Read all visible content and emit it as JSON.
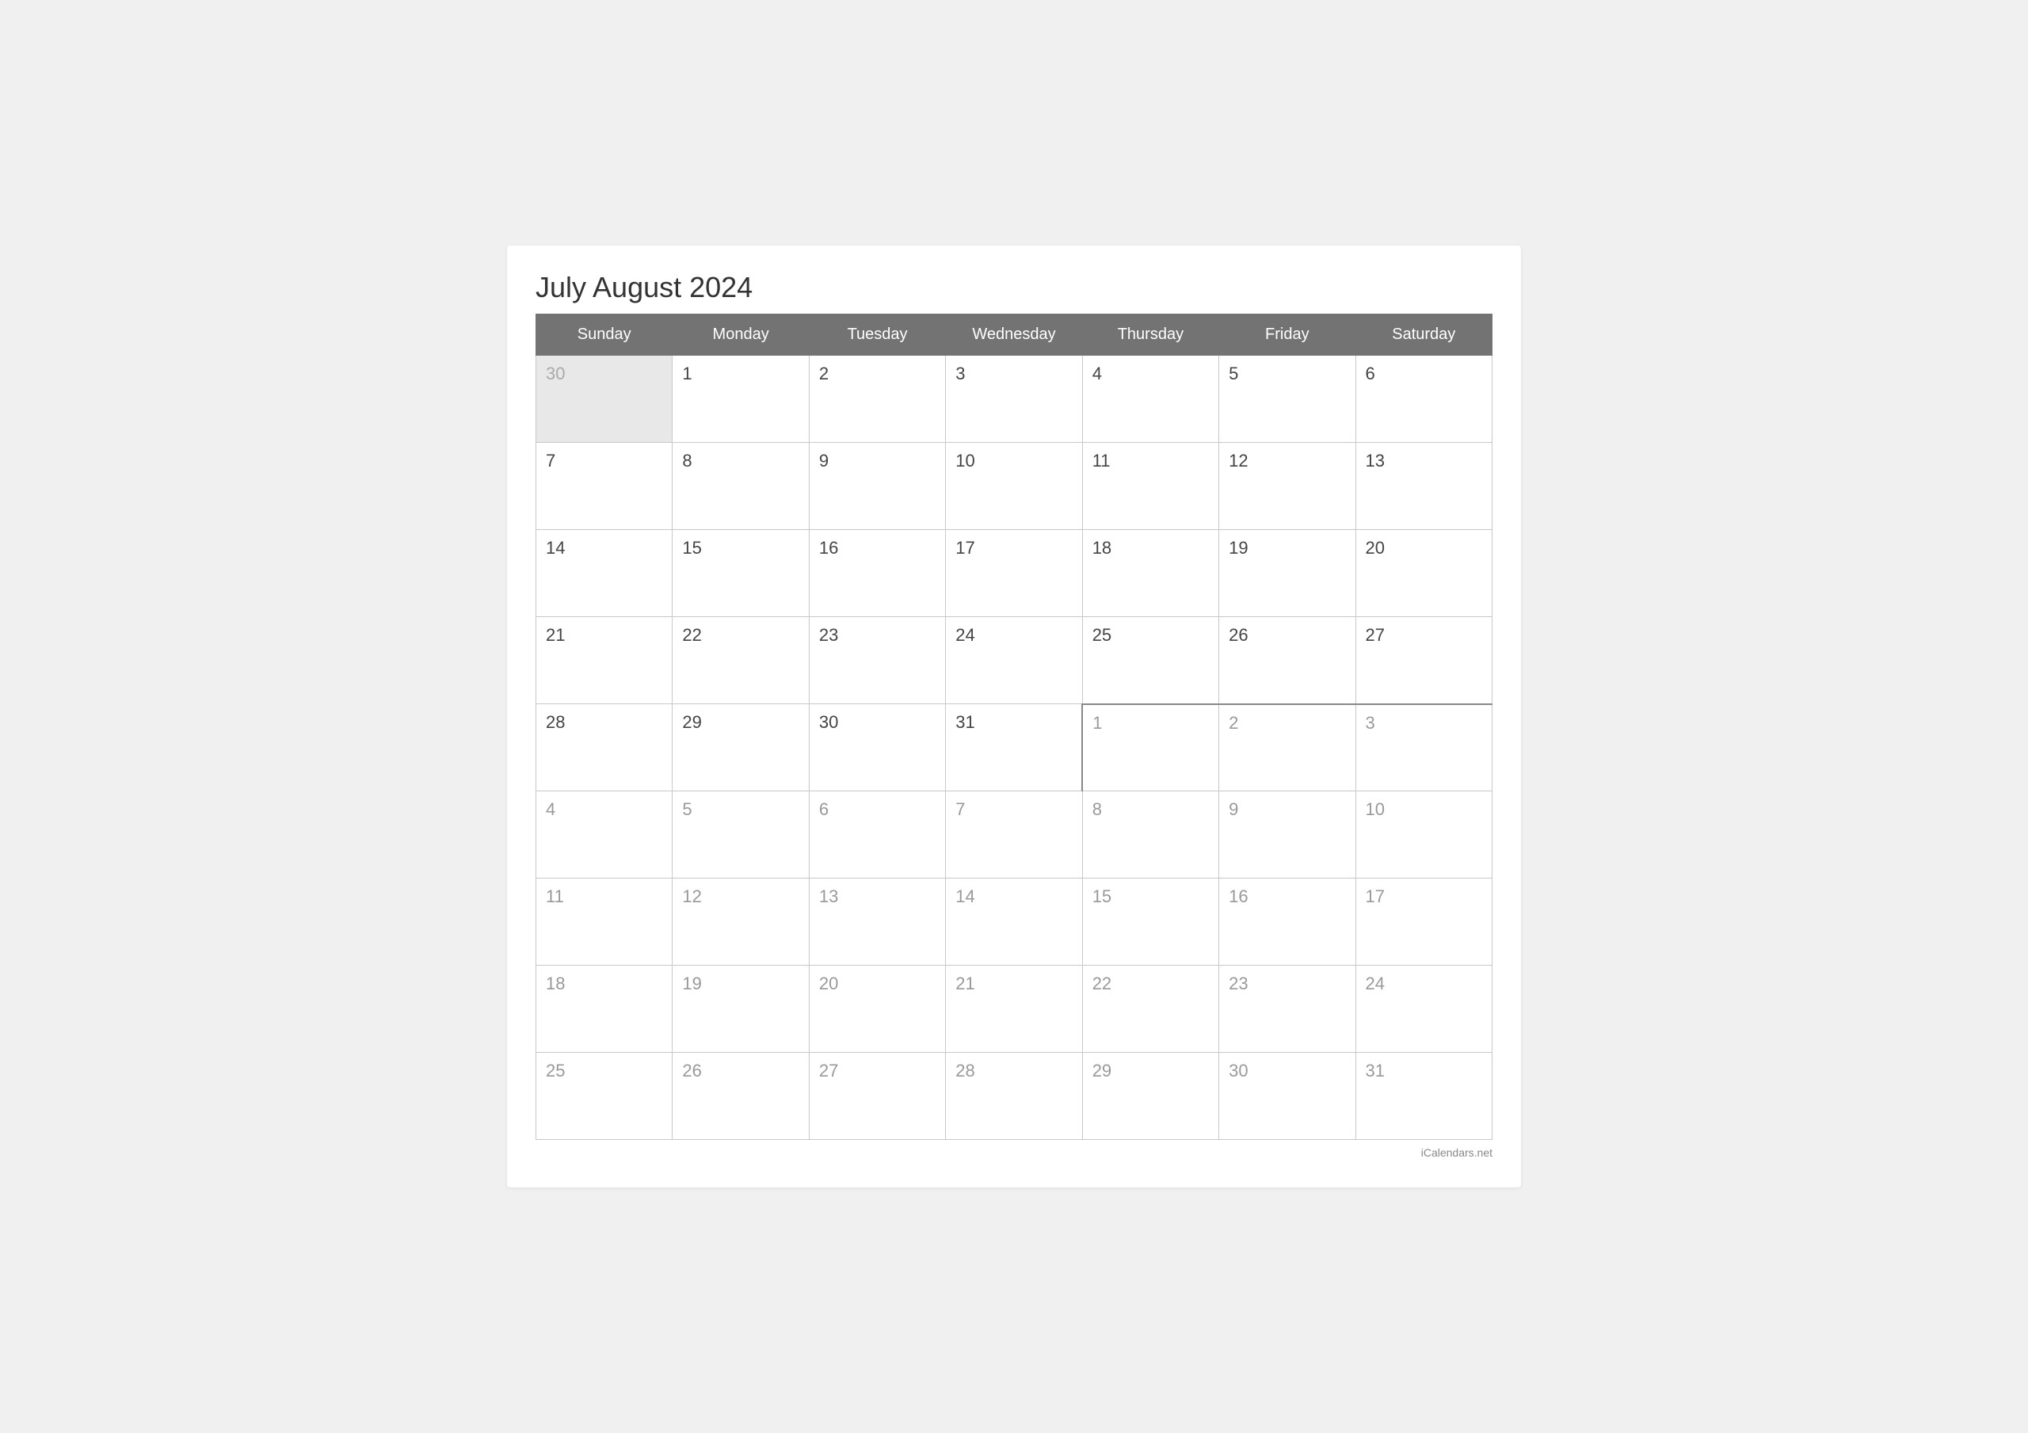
{
  "title": "July August 2024",
  "watermark": "iCalendars.net",
  "header": {
    "days": [
      "Sunday",
      "Monday",
      "Tuesday",
      "Wednesday",
      "Thursday",
      "Friday",
      "Saturday"
    ]
  },
  "weeks": [
    {
      "cells": [
        {
          "day": "30",
          "type": "prev-month"
        },
        {
          "day": "1",
          "type": "current"
        },
        {
          "day": "2",
          "type": "current"
        },
        {
          "day": "3",
          "type": "current"
        },
        {
          "day": "4",
          "type": "current"
        },
        {
          "day": "5",
          "type": "current"
        },
        {
          "day": "6",
          "type": "current"
        }
      ]
    },
    {
      "cells": [
        {
          "day": "7",
          "type": "current"
        },
        {
          "day": "8",
          "type": "current"
        },
        {
          "day": "9",
          "type": "current"
        },
        {
          "day": "10",
          "type": "current"
        },
        {
          "day": "11",
          "type": "current"
        },
        {
          "day": "12",
          "type": "current"
        },
        {
          "day": "13",
          "type": "current"
        }
      ]
    },
    {
      "cells": [
        {
          "day": "14",
          "type": "current"
        },
        {
          "day": "15",
          "type": "current"
        },
        {
          "day": "16",
          "type": "current"
        },
        {
          "day": "17",
          "type": "current"
        },
        {
          "day": "18",
          "type": "current"
        },
        {
          "day": "19",
          "type": "current"
        },
        {
          "day": "20",
          "type": "current"
        }
      ]
    },
    {
      "cells": [
        {
          "day": "21",
          "type": "current"
        },
        {
          "day": "22",
          "type": "current"
        },
        {
          "day": "23",
          "type": "current"
        },
        {
          "day": "24",
          "type": "current"
        },
        {
          "day": "25",
          "type": "current"
        },
        {
          "day": "26",
          "type": "current"
        },
        {
          "day": "27",
          "type": "current"
        }
      ]
    },
    {
      "cells": [
        {
          "day": "28",
          "type": "current"
        },
        {
          "day": "29",
          "type": "current"
        },
        {
          "day": "30",
          "type": "current"
        },
        {
          "day": "31",
          "type": "current"
        },
        {
          "day": "1",
          "type": "next-month",
          "divider": "top-left"
        },
        {
          "day": "2",
          "type": "next-month",
          "divider": "top"
        },
        {
          "day": "3",
          "type": "next-month",
          "divider": "top"
        }
      ]
    },
    {
      "cells": [
        {
          "day": "4",
          "type": "next-month"
        },
        {
          "day": "5",
          "type": "next-month"
        },
        {
          "day": "6",
          "type": "next-month"
        },
        {
          "day": "7",
          "type": "next-month"
        },
        {
          "day": "8",
          "type": "next-month"
        },
        {
          "day": "9",
          "type": "next-month"
        },
        {
          "day": "10",
          "type": "next-month"
        }
      ]
    },
    {
      "cells": [
        {
          "day": "11",
          "type": "next-month"
        },
        {
          "day": "12",
          "type": "next-month"
        },
        {
          "day": "13",
          "type": "next-month"
        },
        {
          "day": "14",
          "type": "next-month"
        },
        {
          "day": "15",
          "type": "next-month"
        },
        {
          "day": "16",
          "type": "next-month"
        },
        {
          "day": "17",
          "type": "next-month"
        }
      ]
    },
    {
      "cells": [
        {
          "day": "18",
          "type": "next-month"
        },
        {
          "day": "19",
          "type": "next-month"
        },
        {
          "day": "20",
          "type": "next-month"
        },
        {
          "day": "21",
          "type": "next-month"
        },
        {
          "day": "22",
          "type": "next-month"
        },
        {
          "day": "23",
          "type": "next-month"
        },
        {
          "day": "24",
          "type": "next-month"
        }
      ]
    },
    {
      "cells": [
        {
          "day": "25",
          "type": "next-month"
        },
        {
          "day": "26",
          "type": "next-month"
        },
        {
          "day": "27",
          "type": "next-month"
        },
        {
          "day": "28",
          "type": "next-month"
        },
        {
          "day": "29",
          "type": "next-month"
        },
        {
          "day": "30",
          "type": "next-month"
        },
        {
          "day": "31",
          "type": "next-month"
        }
      ]
    }
  ]
}
